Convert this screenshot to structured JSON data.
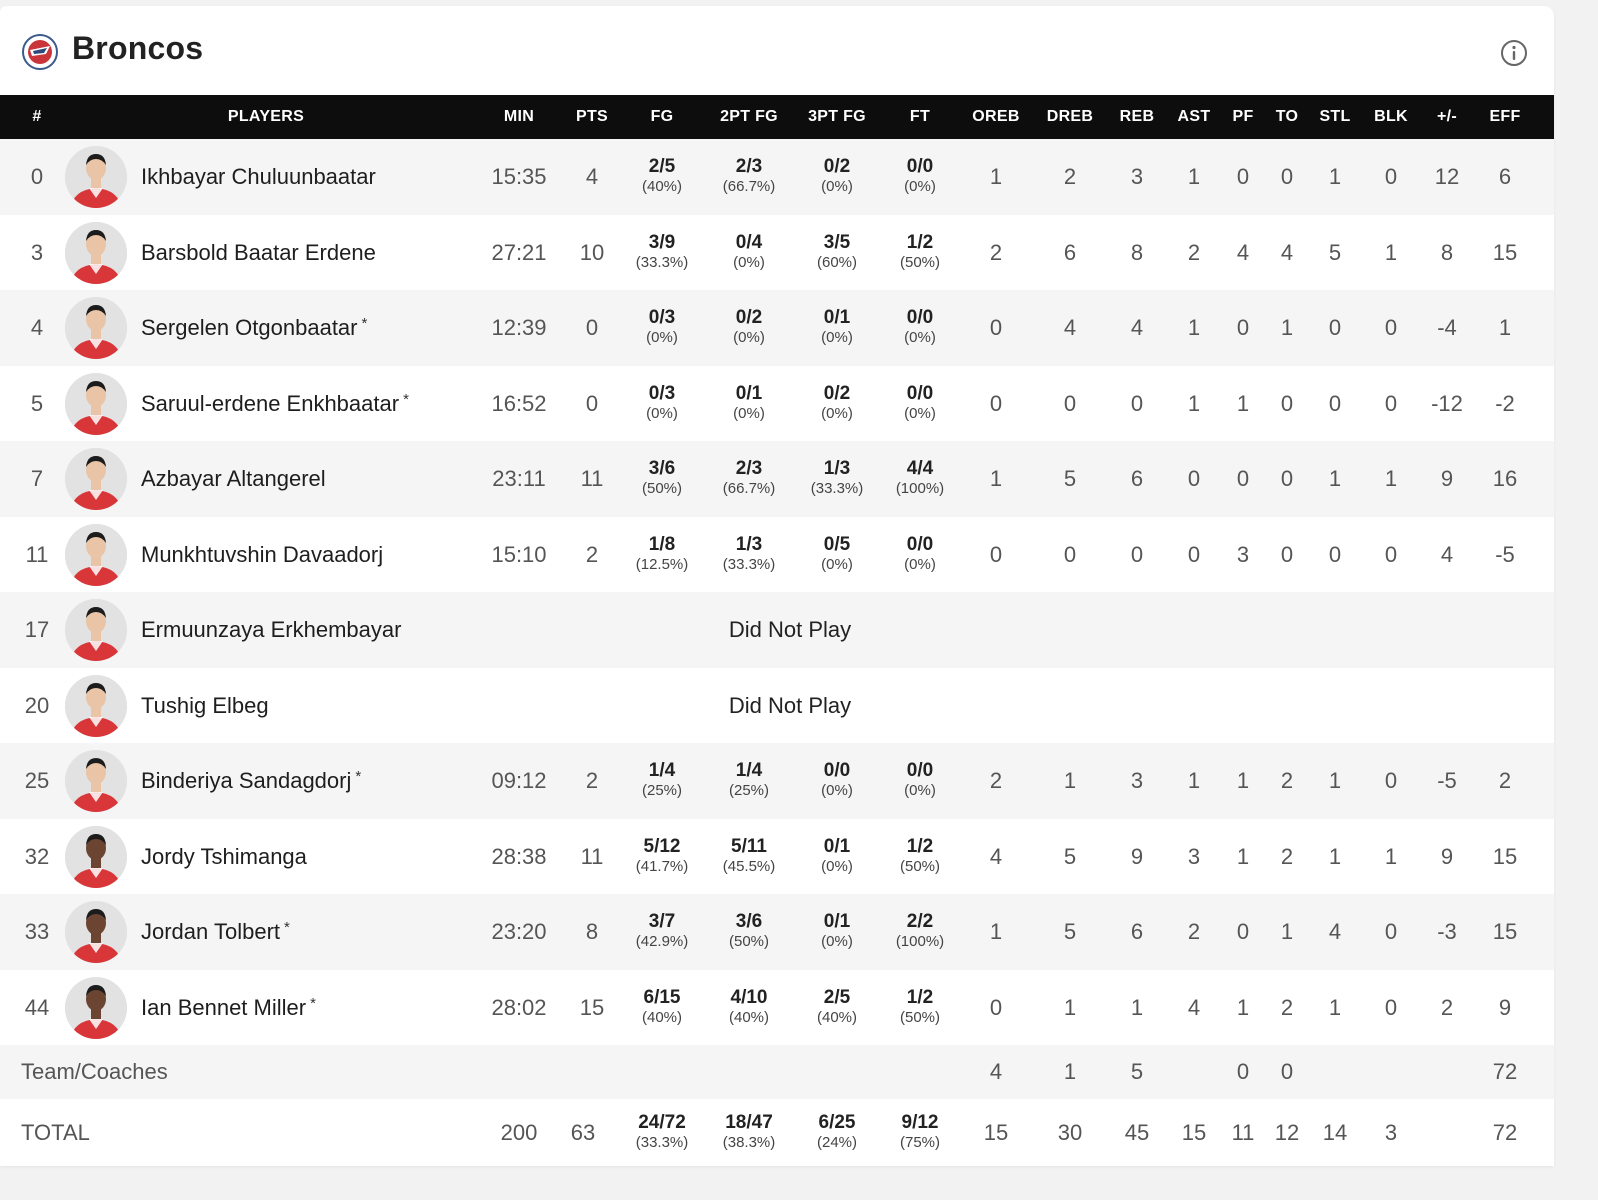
{
  "team": {
    "name": "Broncos"
  },
  "columns": [
    "#",
    "PLAYERS",
    "MIN",
    "PTS",
    "FG",
    "2PT FG",
    "3PT FG",
    "FT",
    "OREB",
    "DREB",
    "REB",
    "AST",
    "PF",
    "TO",
    "STL",
    "BLK",
    "+/-",
    "EFF"
  ],
  "players": [
    {
      "num": "0",
      "name": "Ikhbayar Chuluunbaatar",
      "starter": false,
      "min": "15:35",
      "pts": "4",
      "fg": "2/5",
      "fg_pct": "(40%)",
      "fg2": "2/3",
      "fg2_pct": "(66.7%)",
      "fg3": "0/2",
      "fg3_pct": "(0%)",
      "ft": "0/0",
      "ft_pct": "(0%)",
      "oreb": "1",
      "dreb": "2",
      "reb": "3",
      "ast": "1",
      "pf": "0",
      "to": "0",
      "stl": "1",
      "blk": "0",
      "pm": "12",
      "eff": "6",
      "dnp": ""
    },
    {
      "num": "3",
      "name": "Barsbold Baatar Erdene",
      "starter": false,
      "min": "27:21",
      "pts": "10",
      "fg": "3/9",
      "fg_pct": "(33.3%)",
      "fg2": "0/4",
      "fg2_pct": "(0%)",
      "fg3": "3/5",
      "fg3_pct": "(60%)",
      "ft": "1/2",
      "ft_pct": "(50%)",
      "oreb": "2",
      "dreb": "6",
      "reb": "8",
      "ast": "2",
      "pf": "4",
      "to": "4",
      "stl": "5",
      "blk": "1",
      "pm": "8",
      "eff": "15",
      "dnp": ""
    },
    {
      "num": "4",
      "name": "Sergelen Otgonbaatar",
      "starter": true,
      "min": "12:39",
      "pts": "0",
      "fg": "0/3",
      "fg_pct": "(0%)",
      "fg2": "0/2",
      "fg2_pct": "(0%)",
      "fg3": "0/1",
      "fg3_pct": "(0%)",
      "ft": "0/0",
      "ft_pct": "(0%)",
      "oreb": "0",
      "dreb": "4",
      "reb": "4",
      "ast": "1",
      "pf": "0",
      "to": "1",
      "stl": "0",
      "blk": "0",
      "pm": "-4",
      "eff": "1",
      "dnp": ""
    },
    {
      "num": "5",
      "name": "Saruul-erdene Enkhbaatar",
      "starter": true,
      "min": "16:52",
      "pts": "0",
      "fg": "0/3",
      "fg_pct": "(0%)",
      "fg2": "0/1",
      "fg2_pct": "(0%)",
      "fg3": "0/2",
      "fg3_pct": "(0%)",
      "ft": "0/0",
      "ft_pct": "(0%)",
      "oreb": "0",
      "dreb": "0",
      "reb": "0",
      "ast": "1",
      "pf": "1",
      "to": "0",
      "stl": "0",
      "blk": "0",
      "pm": "-12",
      "eff": "-2",
      "dnp": ""
    },
    {
      "num": "7",
      "name": "Azbayar Altangerel",
      "starter": false,
      "min": "23:11",
      "pts": "11",
      "fg": "3/6",
      "fg_pct": "(50%)",
      "fg2": "2/3",
      "fg2_pct": "(66.7%)",
      "fg3": "1/3",
      "fg3_pct": "(33.3%)",
      "ft": "4/4",
      "ft_pct": "(100%)",
      "oreb": "1",
      "dreb": "5",
      "reb": "6",
      "ast": "0",
      "pf": "0",
      "to": "0",
      "stl": "1",
      "blk": "1",
      "pm": "9",
      "eff": "16",
      "dnp": ""
    },
    {
      "num": "11",
      "name": "Munkhtuvshin Davaadorj",
      "starter": false,
      "min": "15:10",
      "pts": "2",
      "fg": "1/8",
      "fg_pct": "(12.5%)",
      "fg2": "1/3",
      "fg2_pct": "(33.3%)",
      "fg3": "0/5",
      "fg3_pct": "(0%)",
      "ft": "0/0",
      "ft_pct": "(0%)",
      "oreb": "0",
      "dreb": "0",
      "reb": "0",
      "ast": "0",
      "pf": "3",
      "to": "0",
      "stl": "0",
      "blk": "0",
      "pm": "4",
      "eff": "-5",
      "dnp": ""
    },
    {
      "num": "17",
      "name": "Ermuunzaya Erkhembayar",
      "starter": false,
      "dnp": "Did Not Play"
    },
    {
      "num": "20",
      "name": "Tushig Elbeg",
      "starter": false,
      "dnp": "Did Not Play"
    },
    {
      "num": "25",
      "name": "Binderiya Sandagdorj",
      "starter": true,
      "min": "09:12",
      "pts": "2",
      "fg": "1/4",
      "fg_pct": "(25%)",
      "fg2": "1/4",
      "fg2_pct": "(25%)",
      "fg3": "0/0",
      "fg3_pct": "(0%)",
      "ft": "0/0",
      "ft_pct": "(0%)",
      "oreb": "2",
      "dreb": "1",
      "reb": "3",
      "ast": "1",
      "pf": "1",
      "to": "2",
      "stl": "1",
      "blk": "0",
      "pm": "-5",
      "eff": "2",
      "dnp": ""
    },
    {
      "num": "32",
      "name": "Jordy Tshimanga",
      "starter": false,
      "min": "28:38",
      "pts": "11",
      "fg": "5/12",
      "fg_pct": "(41.7%)",
      "fg2": "5/11",
      "fg2_pct": "(45.5%)",
      "fg3": "0/1",
      "fg3_pct": "(0%)",
      "ft": "1/2",
      "ft_pct": "(50%)",
      "oreb": "4",
      "dreb": "5",
      "reb": "9",
      "ast": "3",
      "pf": "1",
      "to": "2",
      "stl": "1",
      "blk": "1",
      "pm": "9",
      "eff": "15",
      "dnp": ""
    },
    {
      "num": "33",
      "name": "Jordan Tolbert",
      "starter": true,
      "min": "23:20",
      "pts": "8",
      "fg": "3/7",
      "fg_pct": "(42.9%)",
      "fg2": "3/6",
      "fg2_pct": "(50%)",
      "fg3": "0/1",
      "fg3_pct": "(0%)",
      "ft": "2/2",
      "ft_pct": "(100%)",
      "oreb": "1",
      "dreb": "5",
      "reb": "6",
      "ast": "2",
      "pf": "0",
      "to": "1",
      "stl": "4",
      "blk": "0",
      "pm": "-3",
      "eff": "15",
      "dnp": ""
    },
    {
      "num": "44",
      "name": "Ian Bennet Miller",
      "starter": true,
      "min": "28:02",
      "pts": "15",
      "fg": "6/15",
      "fg_pct": "(40%)",
      "fg2": "4/10",
      "fg2_pct": "(40%)",
      "fg3": "2/5",
      "fg3_pct": "(40%)",
      "ft": "1/2",
      "ft_pct": "(50%)",
      "oreb": "0",
      "dreb": "1",
      "reb": "1",
      "ast": "4",
      "pf": "1",
      "to": "2",
      "stl": "1",
      "blk": "0",
      "pm": "2",
      "eff": "9",
      "dnp": ""
    }
  ],
  "team_coaches": {
    "label": "Team/Coaches",
    "oreb": "4",
    "dreb": "1",
    "reb": "5",
    "pf": "0",
    "to": "0",
    "eff": "72"
  },
  "total": {
    "label": "TOTAL",
    "min": "200",
    "pts": "63",
    "fg": "24/72",
    "fg_pct": "(33.3%)",
    "fg2": "18/47",
    "fg2_pct": "(38.3%)",
    "fg3": "6/25",
    "fg3_pct": "(24%)",
    "ft": "9/12",
    "ft_pct": "(75%)",
    "oreb": "15",
    "dreb": "30",
    "reb": "45",
    "ast": "15",
    "pf": "11",
    "to": "12",
    "stl": "14",
    "blk": "3",
    "eff": "72"
  },
  "starter_mark": "*",
  "colors": {
    "header_bg": "#0d0d0d",
    "row_alt": "#f5f5f6",
    "jersey": "#d9363a"
  }
}
